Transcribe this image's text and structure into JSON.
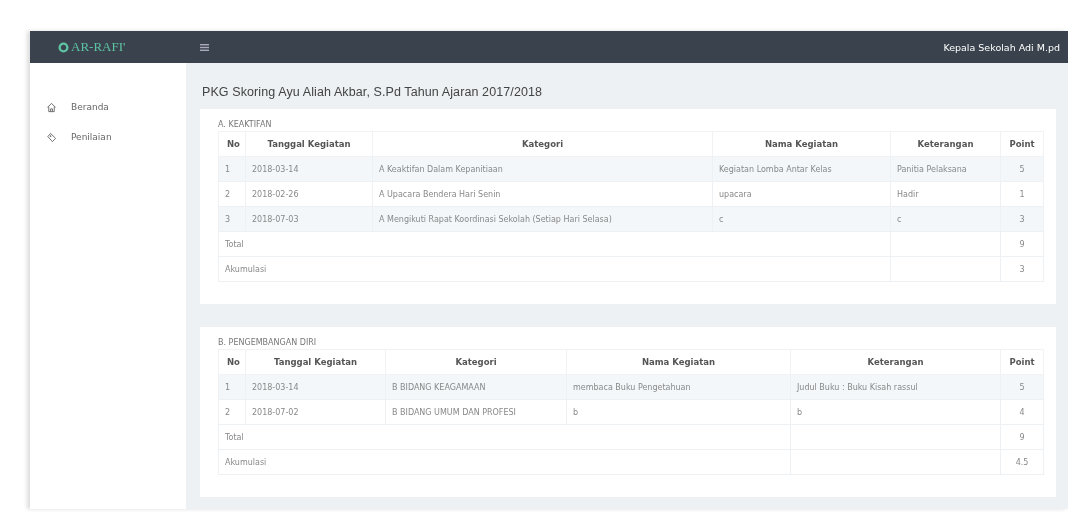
{
  "brand": "AR-RAFI'",
  "user": "Kepala Sekolah Adi M.pd",
  "sidebar": {
    "items": [
      {
        "label": "Beranda"
      },
      {
        "label": "Penilaian"
      }
    ]
  },
  "title": "PKG Skoring Ayu Aliah Akbar, S.Pd Tahun Ajaran 2017/2018",
  "sections": [
    {
      "title": "A. KEAKTIFAN",
      "columns": [
        "No",
        "Tanggal Kegiatan",
        "Kategori",
        "Nama Kegiatan",
        "Keterangan",
        "Point"
      ],
      "rows": [
        [
          "1",
          "2018-03-14",
          "A Keaktifan Dalam Kepanitiaan",
          "Kegiatan Lomba Antar Kelas",
          "Panitia Pelaksana",
          "5"
        ],
        [
          "2",
          "2018-02-26",
          "A Upacara Bendera Hari Senin",
          "upacara",
          "Hadir",
          "1"
        ],
        [
          "3",
          "2018-07-03",
          "A Mengikuti Rapat Koordinasi Sekolah (Setiap Hari Selasa)",
          "c",
          "c",
          "3"
        ]
      ],
      "summary": [
        {
          "label": "Total",
          "value": "9"
        },
        {
          "label": "Akumulasi",
          "value": "3"
        }
      ]
    },
    {
      "title": "B. PENGEMBANGAN DIRI",
      "columns": [
        "No",
        "Tanggal Kegiatan",
        "Kategori",
        "Nama Kegiatan",
        "Keterangan",
        "Point"
      ],
      "rows": [
        [
          "1",
          "2018-03-14",
          "B BIDANG KEAGAMAAN",
          "membaca Buku Pengetahuan",
          "Judul Buku : Buku Kisah rassul",
          "5"
        ],
        [
          "2",
          "2018-07-02",
          "B BIDANG UMUM DAN PROFESI",
          "b",
          "b",
          "4"
        ]
      ],
      "summary": [
        {
          "label": "Total",
          "value": "9"
        },
        {
          "label": "Akumulasi",
          "value": "4.5"
        }
      ]
    }
  ]
}
